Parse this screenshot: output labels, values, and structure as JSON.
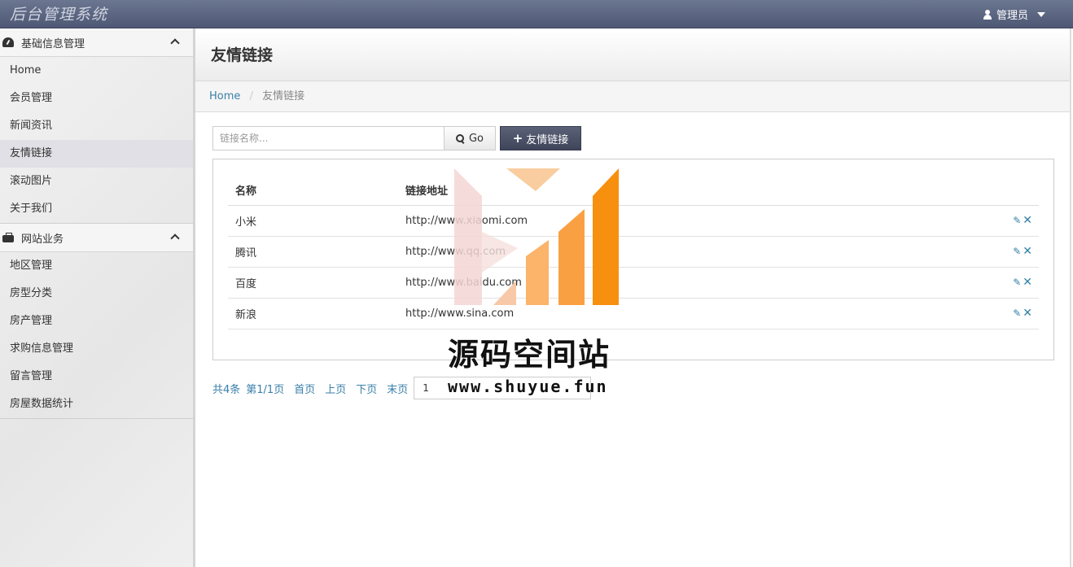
{
  "topbar": {
    "brand": "后台管理系统",
    "user_label": "管理员"
  },
  "sidebar": {
    "groups": [
      {
        "title": "基础信息管理",
        "icon": "dashboard-icon",
        "items": [
          {
            "label": "Home"
          },
          {
            "label": "会员管理"
          },
          {
            "label": "新闻资讯"
          },
          {
            "label": "友情链接",
            "active": true
          },
          {
            "label": "滚动图片"
          },
          {
            "label": "关于我们"
          }
        ]
      },
      {
        "title": "网站业务",
        "icon": "briefcase-icon",
        "items": [
          {
            "label": "地区管理"
          },
          {
            "label": "房型分类"
          },
          {
            "label": "房产管理"
          },
          {
            "label": "求购信息管理"
          },
          {
            "label": "留言管理"
          },
          {
            "label": "房屋数据统计"
          }
        ]
      }
    ]
  },
  "main": {
    "title": "友情链接",
    "breadcrumb": {
      "home": "Home",
      "current": "友情链接"
    },
    "search": {
      "placeholder": "链接名称...",
      "go_label": "Go"
    },
    "add_label": "友情链接",
    "table": {
      "headers": [
        "名称",
        "链接地址"
      ],
      "rows": [
        {
          "name": "小米",
          "url": "http://www.xiaomi.com"
        },
        {
          "name": "腾讯",
          "url": "http://www.qq.com"
        },
        {
          "name": "百度",
          "url": "http://www.baidu.com"
        },
        {
          "name": "新浪",
          "url": "http://www.sina.com"
        }
      ]
    },
    "pager": {
      "total": "共4条",
      "page_info": "第1/1页",
      "first": "首页",
      "prev": "上页",
      "next": "下页",
      "last": "末页",
      "select_value": "1"
    }
  },
  "watermark": {
    "text": "源码空间站",
    "url": "www.shuyue.fun"
  },
  "colors": {
    "topbar": "#5b6580",
    "accent_link": "#3a7fa8",
    "add_button": "#4a5066",
    "watermark_orange": "#f7941d"
  }
}
